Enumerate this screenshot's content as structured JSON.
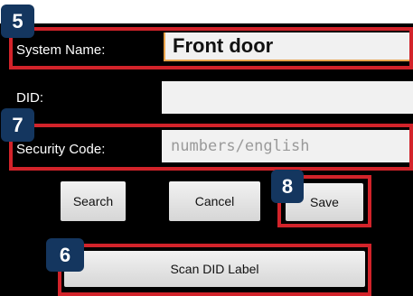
{
  "form": {
    "system_name_label": "System Name:",
    "system_name_value": "Front door",
    "did_label": "DID:",
    "did_value": "",
    "security_code_label": "Security Code:",
    "security_code_placeholder": "numbers/english"
  },
  "buttons": {
    "search": "Search",
    "cancel": "Cancel",
    "save": "Save",
    "scan": "Scan DID Label"
  },
  "annotations": {
    "badge_system_name": "5",
    "badge_security_code": "7",
    "badge_save": "8",
    "badge_scan": "6",
    "highlight_color": "#d2232a",
    "badge_color": "#14365f"
  }
}
